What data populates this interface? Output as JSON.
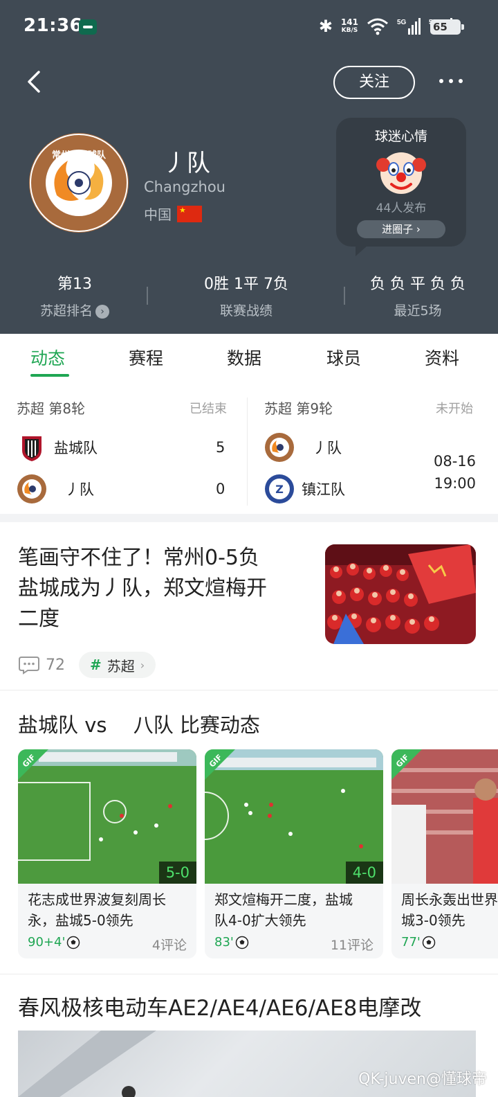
{
  "status_bar": {
    "time": "21:36",
    "net_speed": "141",
    "net_unit": "KB/S",
    "sim1": "5G",
    "sim2": "5G",
    "battery": "65"
  },
  "header": {
    "follow_label": "关注",
    "team_name": "丿队",
    "team_en": "Changzhou",
    "country": "中国",
    "logo_text": "常州市足球队",
    "mood": {
      "title": "球迷心情",
      "count": "44人发布",
      "button": "进圈子"
    },
    "stats": [
      {
        "value": "第13",
        "label": "苏超排名"
      },
      {
        "value": "0胜 1平 7负",
        "label": "联赛战绩"
      },
      {
        "value": "负 负 平 负 负",
        "label": "最近5场"
      }
    ]
  },
  "tabs": [
    "动态",
    "赛程",
    "数据",
    "球员",
    "资料"
  ],
  "matches": [
    {
      "league": "苏超 第8轮",
      "status": "已结束",
      "home": "盐城队",
      "home_score": "5",
      "away": "丿队",
      "away_score": "0"
    },
    {
      "league": "苏超 第9轮",
      "status": "未开始",
      "home": "丿队",
      "away": "镇江队",
      "date": "08-16",
      "time": "19:00"
    }
  ],
  "news": {
    "title_line1": "笔画守不住了！常州0-5负",
    "title_line2": "盐城成为丿队，郑文煊梅开",
    "title_line3": "二度",
    "comments": "72",
    "tag": "苏超"
  },
  "live": {
    "title": "盐城队 vs 　八队 比赛动态",
    "cards": [
      {
        "score": "5-0",
        "line1": "花志成世界波复刻周长",
        "line2": "永，盐城5-0领先",
        "minute": "90+4'",
        "comments": "4评论"
      },
      {
        "score": "4-0",
        "line1": "郑文煊梅开二度，盐城",
        "line2": "队4-0扩大领先",
        "minute": "83'",
        "comments": "11评论"
      },
      {
        "score": "",
        "line1": "周长永轰出世界",
        "line2": "城3-0领先",
        "minute": "77'",
        "comments": ""
      }
    ]
  },
  "ad": {
    "title": "春风极核电动车AE2/AE4/AE6/AE8电摩改"
  },
  "watermark": "QK-juven@懂球帝"
}
